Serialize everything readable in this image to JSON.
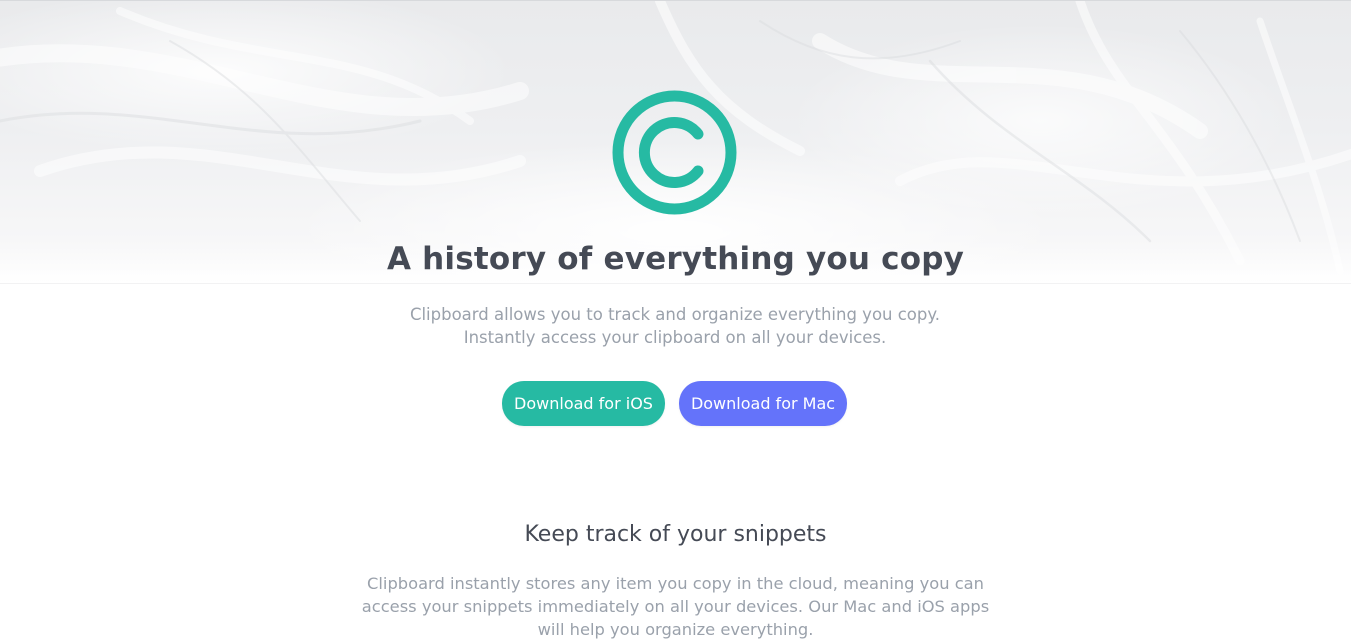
{
  "hero": {
    "logo_icon": "copyright-icon",
    "accent_color": "#26baa3",
    "title": "A history of everything you copy",
    "subtitle_lines": [
      "Clipboard allows you to track and organize everything you copy.",
      "Instantly access your clipboard on all your devices."
    ],
    "buttons": {
      "ios_label": "Download for iOS",
      "ios_color": "#26baa3",
      "mac_label": "Download for Mac",
      "mac_color": "#6473fa"
    }
  },
  "snippets_section": {
    "title": "Keep track of your snippets",
    "body_lines": [
      "Clipboard instantly stores any item you copy in the cloud, meaning you can",
      "access your snippets immediately on all your devices. Our Mac and iOS apps",
      "will help you organize everything."
    ]
  }
}
